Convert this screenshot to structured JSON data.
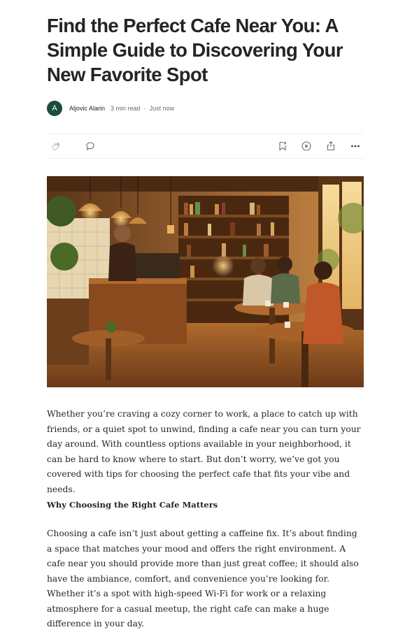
{
  "article": {
    "title": "Find the Perfect Cafe Near You: A\nSimple Guide to Discovering Your\nNew Favorite Spot",
    "author_initial": "A",
    "author": "Aljovic Alarin",
    "read_time": "3 min read",
    "separator": "·",
    "published": "Just now"
  },
  "actions": {
    "icons": [
      "clap-icon",
      "comment-icon",
      "bookmark-add-icon",
      "play-icon",
      "share-icon",
      "more-icon"
    ]
  },
  "hero_image": {
    "subject": "cafe-interior-illustration"
  },
  "content": {
    "paragraph_1": "Whether you’re craving a cozy corner to work, a place to catch up with friends, or a quiet spot to unwind, finding a cafe near you can turn your day around. With countless options available in your neighborhood, it can be hard to know where to start. But don’t worry, we’ve got you covered with tips for choosing the perfect cafe that fits your vibe and needs.",
    "heading_1": "Why Choosing the Right Cafe Matters",
    "paragraph_2": "Choosing a cafe isn’t just about getting a caffeine fix. It’s about finding a space that matches your mood and offers the right environment. A cafe near you should provide more than just great coffee; it should also have the ambiance, comfort, and convenience you’re looking for. Whether it’s a spot with high-speed Wi-Fi for work or a relaxing atmosphere for a casual meetup, the right cafe can make a huge difference in your day."
  },
  "colors": {
    "text": "#242424",
    "muted": "#6b6b6b",
    "avatar_bg": "#1a4d3a",
    "divider": "#f0f0f0"
  }
}
